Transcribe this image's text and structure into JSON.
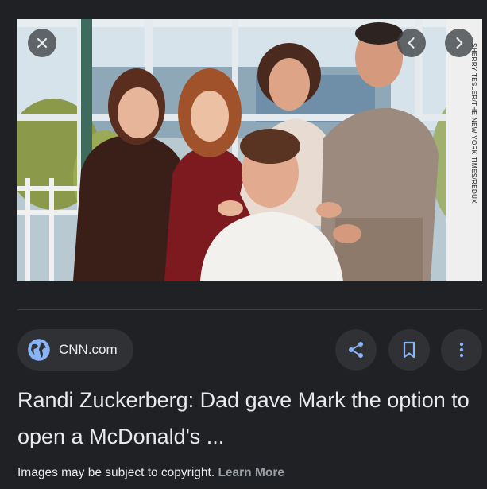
{
  "image": {
    "credit": "SHERRY TESLER/THE NEW YORK TIMES/REDUX"
  },
  "controls": {
    "close_icon": "close-icon",
    "prev_icon": "chevron-left-icon",
    "next_icon": "chevron-right-icon"
  },
  "source": {
    "name": "CNN.com",
    "icon": "globe-icon",
    "icon_color": "#8ab4f8"
  },
  "actions": {
    "share_icon": "share-icon",
    "save_icon": "bookmark-icon",
    "more_icon": "more-vert-icon",
    "accent": "#8ab4f8"
  },
  "title": "Randi Zuckerberg: Dad gave Mark the option to open a McDonald's ...",
  "copyright": {
    "text": "Images may be subject to copyright.",
    "link": "Learn More"
  }
}
